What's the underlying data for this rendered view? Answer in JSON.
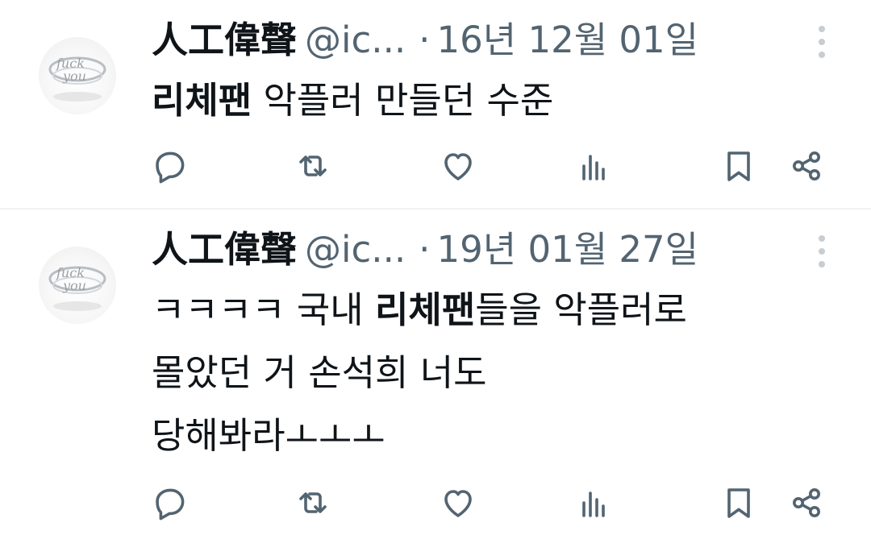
{
  "colors": {
    "text": "#0f1419",
    "secondary": "#536471",
    "icon": "#536471",
    "divider": "#eff3f4"
  },
  "tweets": [
    {
      "author": {
        "display_name": "人工偉聲",
        "handle": "@ic...",
        "avatar": "ring-avatar"
      },
      "separator": "·",
      "timestamp": "16년 12월 01일",
      "text": {
        "line1": {
          "bold": "리체팬",
          "rest": " 악플러 만들던 수준"
        }
      },
      "actions": [
        "reply-icon",
        "retweet-icon",
        "like-icon",
        "views-icon",
        "bookmark-icon",
        "share-icon"
      ]
    },
    {
      "author": {
        "display_name": "人工偉聲",
        "handle": "@ic...",
        "avatar": "ring-avatar"
      },
      "separator": "·",
      "timestamp": "19년 01월 27일",
      "text": {
        "line1": {
          "pre": "ㅋㅋㅋㅋ 국내 ",
          "bold": "리체팬",
          "rest": "들을 악플러로"
        },
        "line2": "몰았던 거 손석희 너도",
        "line3": "당해봐라ㅗㅗㅗ"
      },
      "actions": [
        "reply-icon",
        "retweet-icon",
        "like-icon",
        "views-icon",
        "bookmark-icon",
        "share-icon"
      ]
    }
  ]
}
